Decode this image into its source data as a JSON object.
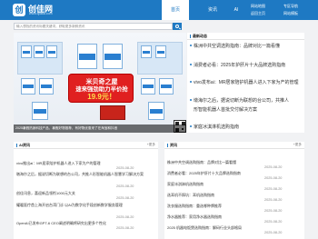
{
  "header": {
    "logo_mark": "创",
    "logo_name": "创佳网",
    "logo_domain": "www.cjiaka.com",
    "nav": [
      {
        "label": "首页",
        "active": true
      },
      {
        "label": "资讯",
        "active": false
      },
      {
        "label": "AI",
        "active": false
      }
    ],
    "side_links": [
      "网站地图",
      "返回主页",
      "专区导航",
      "网站模板"
    ]
  },
  "search": {
    "placeholder": "输入想找的资讯标题关键词，获取更多新鲜资讯"
  },
  "slider": {
    "promo_line1": "米贝奇之屋",
    "promo_line2": "速来强劲助力半价抢",
    "promo_price": "19.9元！",
    "caption": "2025暑假热销科技产品，暑假好物推荐，有好物优惠来了在淘宝和抖音",
    "dots": 4,
    "active_dot": 3
  },
  "top_news": {
    "title": "最新动态",
    "items": [
      "株洲中共空调选购指南：品牌对比一篇看懂",
      "消费者必看：2025年护肝片十大品牌选购指南",
      "vivo发布ai：MR居家陪护机器人进入下家为产的管理",
      "墩海尔之后，据说切断为联想的台公司，共推人",
      "形智能机器人首批交付解决方案",
      "家庭冰淇淋机选购指南"
    ]
  },
  "ai_panel": {
    "title": "AI资讯",
    "more": "+更多",
    "items": [
      {
        "text": "vivo推出ai：MR居家陪护机器人进入下家为产的管理",
        "date": "2025-08-20"
      },
      {
        "text": "墩海尔之后，据说切断为联想的台公司，共推人形智能机器人智慧学习解决方案",
        "date": "2025-08-20"
      },
      {
        "text": "创佳讯息，喜迎新品领衔1000元大关",
        "date": "2025-08-20"
      },
      {
        "text": "耀暖医疗首上海开启台湾门诊 以AI为数字化手段创新数学服务管理",
        "date": "2025-08-20"
      },
      {
        "text": "OpenAI已发布GPT-6 CEO阐述明确将研究出更多个性化",
        "date": "2025-08-20"
      }
    ]
  },
  "zx_panel": {
    "title": "资讯",
    "more": "+更多",
    "items": [
      {
        "text": "株洲中共空调选购指南：品牌对比一篇看懂",
        "date": "2025-08-20"
      },
      {
        "text": "消费者必看：2025年护肝片十大品牌选购指南",
        "date": "2025-08-20"
      },
      {
        "text": "家庭冰淇淋机选购指南",
        "date": "2025-08-20"
      },
      {
        "text": "选耳机不踩坑：耳机选购指南",
        "date": "2025-08-20"
      },
      {
        "text": "洗衣服选购指南：重选哪种牌推荐",
        "date": "2025-08-20"
      },
      {
        "text": "净水器推荐：家用净水器选购指南",
        "date": "2025-08-20"
      },
      {
        "text": "2025 机器电饭煲选购指南：解码行业头部格局",
        "date": "2025-08-20"
      }
    ]
  },
  "colors": {
    "brand": "#1e79c3",
    "promo": "#e02020"
  }
}
